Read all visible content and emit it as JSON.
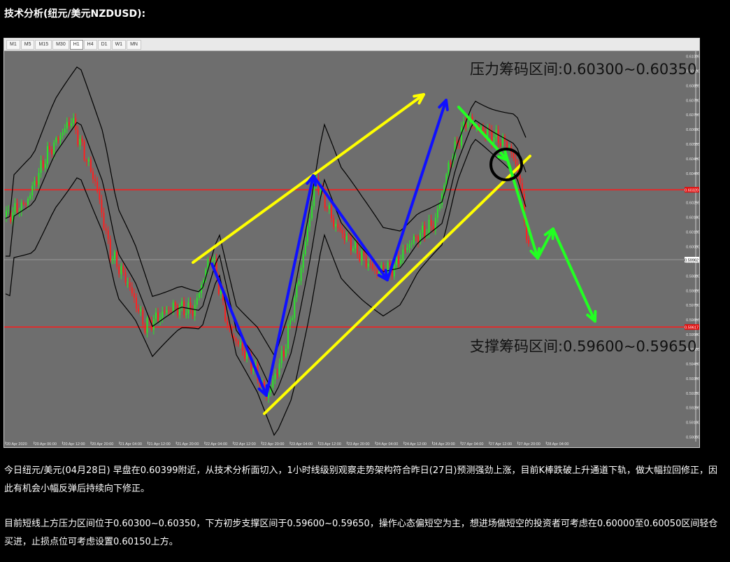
{
  "page_title": "技术分析(纽元/美元NZDUSD):",
  "timeframes": [
    "M1",
    "M5",
    "M15",
    "M30",
    "H1",
    "H4",
    "D1",
    "W1",
    "MN"
  ],
  "active_timeframe": "H1",
  "annotations": {
    "resistance": "压力筹码区间:0.60300~0.60350",
    "support": "支撑筹码区间:0.59600~0.59650"
  },
  "chart_data": {
    "type": "candlestick",
    "symbol": "NZDUSD",
    "timeframe": "H1",
    "y_ticks": [
      "0.61005",
      "0.60930",
      "0.60855",
      "0.60780",
      "0.60705",
      "0.60630",
      "0.60555",
      "0.60480",
      "0.60405",
      "0.60330",
      "0.60255",
      "0.60180",
      "0.60105",
      "0.60030",
      "0.59955",
      "0.59880",
      "0.59805",
      "0.59730",
      "0.59655",
      "0.59580",
      "0.59505",
      "0.59430",
      "0.59355",
      "0.59280",
      "0.59205",
      "0.59130",
      "0.59055"
    ],
    "x_ticks": [
      "20 Apr 2020",
      "20 Apr 06:00",
      "20 Apr 12:00",
      "20 Apr 20:00",
      "21 Apr 04:00",
      "21 Apr 12:00",
      "21 Apr 20:00",
      "22 Apr 04:00",
      "22 Apr 12:00",
      "22 Apr 20:00",
      "23 Apr 04:00",
      "23 Apr 12:00",
      "23 Apr 20:00",
      "24 Apr 04:00",
      "24 Apr 12:00",
      "24 Apr 20:00",
      "27 Apr 04:00",
      "27 Apr 12:00",
      "27 Apr 20:00",
      "28 Apr 04:00"
    ],
    "ylim": [
      0.5903,
      0.6103
    ],
    "resistance_level": 0.6032,
    "support_level": 0.59617,
    "current_price": 0.59962,
    "resistance_label": "0.60320",
    "support_label": "0.59617",
    "current_label": "0.59962",
    "colors": {
      "up": "#28e628",
      "down": "#ff2020",
      "hline": "#ff1a1a",
      "channel": "#ffff00",
      "wave": "#1010ff",
      "forecast": "#22ff22"
    }
  },
  "paragraphs": [
    "今日纽元/美元(04月28日) 早盘在0.60399附近，从技术分析面切入，1小时线级别观察走势架构符合昨日(27日)预测强劲上涨，目前K棒跌破上升通道下轨，做大幅拉回修正，因此有机会小幅反弹后持续向下修正。",
    "目前短线上方压力区间位于0.60300~0.60350，下方初步支撑区间于0.59600~0.59650，操作心态偏短空为主，想进场做短空的投资者可考虑在0.60000至0.60050区间轻仓买进，止损点位可考虑设置0.60150上方。"
  ]
}
